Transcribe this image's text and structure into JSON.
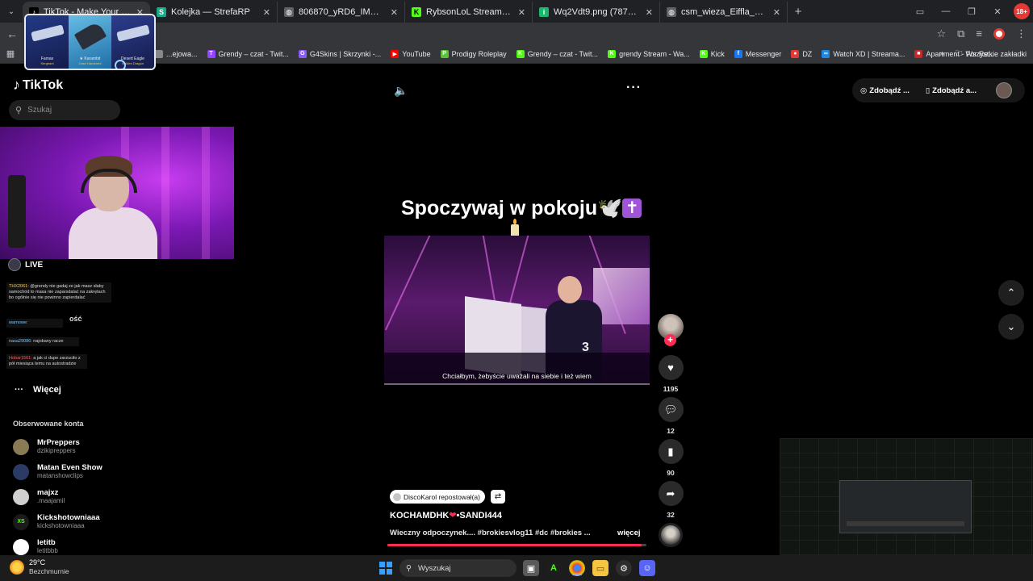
{
  "browser": {
    "tabs": [
      {
        "title": "TikTok - Make Your Day",
        "favicon": "tiktok-icon",
        "active": true
      },
      {
        "title": "Kolejka — StrefaRP",
        "favicon": "strefarp-icon",
        "active": false
      },
      {
        "title": "806870_yRD6_IMG_3383_C120...",
        "favicon": "globe-icon",
        "active": false
      },
      {
        "title": "RybsonLoL Stream - Watch Live...",
        "favicon": "kick-icon",
        "active": false
      },
      {
        "title": "Wq2Vdt9.png (787×451)",
        "favicon": "imgur-icon",
        "active": false
      },
      {
        "title": "csm_wieza_Eiffla_Rybniki_fot.M...",
        "favicon": "globe-icon",
        "active": false
      }
    ],
    "bookmarks": [
      {
        "label": "...ejowa...",
        "color": "#888888",
        "glyph": ""
      },
      {
        "label": "Grendy – czat - Twit...",
        "color": "#9146ff",
        "glyph": "T"
      },
      {
        "label": "G4Skins | Skrzynki -...",
        "color": "#8a5cf6",
        "glyph": "G"
      },
      {
        "label": "YouTube",
        "color": "#ff0000",
        "glyph": "▶"
      },
      {
        "label": "Prodigy Roleplay",
        "color": "#5cc23a",
        "glyph": "P"
      },
      {
        "label": "Grendy – czat - Twit...",
        "color": "#53fc18",
        "glyph": "K"
      },
      {
        "label": "grendy Stream - Wa...",
        "color": "#53fc18",
        "glyph": "K"
      },
      {
        "label": "Kick",
        "color": "#53fc18",
        "glyph": "K"
      },
      {
        "label": "Messenger",
        "color": "#1877f2",
        "glyph": "f"
      },
      {
        "label": "DZ",
        "color": "#e53935",
        "glyph": "●"
      },
      {
        "label": "Watch XD | Streama...",
        "color": "#1e88e5",
        "glyph": "∞"
      },
      {
        "label": "Apartment - For Re...",
        "color": "#c62828",
        "glyph": "■"
      }
    ],
    "bookmarks_all": "Wszystkie zakładki",
    "profile_badge": "18+"
  },
  "tab_preview": {
    "cards": [
      {
        "name": "Famas",
        "sub": "Sergeant"
      },
      {
        "name": "★ Karambit",
        "sub": "Case Hardened"
      },
      {
        "name": "Desert Eagle",
        "sub": "Golden Dragon"
      }
    ]
  },
  "tiktok": {
    "logo": "TikTok",
    "search_placeholder": "Szukaj",
    "more_label": "Więcej",
    "followed_heading": "Obserwowane konta",
    "followed": [
      {
        "name": "MrPreppers",
        "handle": "dzikipreppers",
        "color": "#8a7a55",
        "glyph": ""
      },
      {
        "name": "Matan Even Show",
        "handle": "matanshowclips",
        "color": "#2c3a66",
        "glyph": ""
      },
      {
        "name": "majxz",
        "handle": ".maajamil",
        "color": "#cfcfcf",
        "glyph": ""
      },
      {
        "name": "Kickshotowniaaa",
        "handle": "kickshotowniaaa",
        "color": "#1a1a1a",
        "glyph": "XS"
      },
      {
        "name": "letitb",
        "handle": "letitbbb",
        "color": "#ffffff",
        "glyph": ""
      }
    ],
    "top_actions": {
      "coins": "Zdobądź ...",
      "app": "Zdobądź a..."
    },
    "post": {
      "headline": "Spoczywaj w pokoju🕊️",
      "cross": "✝",
      "subtitle": "Chciałbym, żebyście uważali na siebie i też wiem",
      "reposter": "DiscoKarol repostował(a)",
      "author": "KOCHAMDHK",
      "author_rest": "•SANDI444",
      "description": "Wieczny odpoczynek.... #brokiesvlog11 #dc #brokies ...",
      "see_more": "więcej",
      "likes": "1195",
      "comments": "12",
      "saves": "90",
      "shares": "32",
      "progress": 0.98
    }
  },
  "stream_overlay": {
    "live_label": "LIVE",
    "chat": [
      {
        "user": "THX2061:",
        "text": "@grendy nie gadaj ze jak masz słaby samochód to masa nie zaparsdalać na zakrętach bo ogólnie się nie powinno zapierdalać",
        "ucolor": "u"
      },
      {
        "user": "warnowe:",
        "text": "",
        "ucolor": "u2"
      },
      {
        "user": "nasa29086:",
        "text": "najobany racze",
        "ucolor": "u2"
      },
      {
        "user": "Hobar1561:",
        "text": "a jak ci dupe zarzuciło z pół miesiąca temu na autostradzie",
        "ucolor": "u3"
      }
    ],
    "ghost_text": "ość"
  },
  "taskbar": {
    "temp": "29°C",
    "condition": "Bezchmurnie",
    "search": "Wyszukaj"
  }
}
